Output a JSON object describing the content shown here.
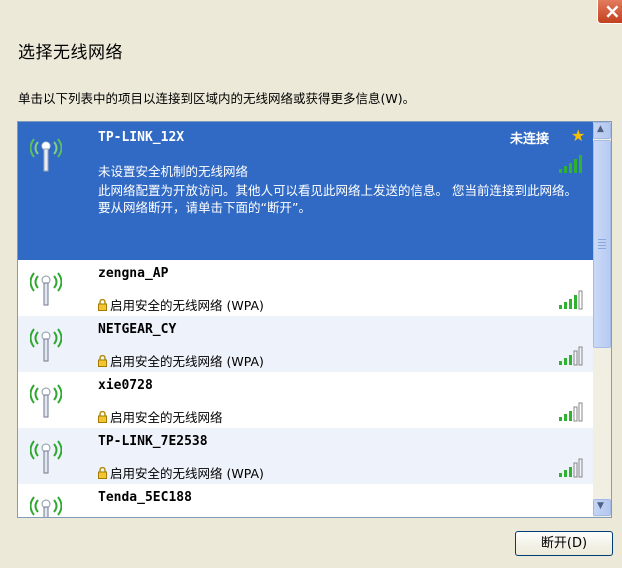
{
  "window": {
    "close_label": "×"
  },
  "header": {
    "title": "选择无线网络",
    "instruction": "单击以下列表中的项目以连接到区域内的无线网络或获得更多信息(W)。"
  },
  "networks": [
    {
      "ssid": "TP-LINK_12X",
      "status": "未连接",
      "security_text": "未设置安全机制的无线网络",
      "description": "此网络配置为开放访问。其他人可以看见此网络上发送的信息。 您当前连接到此网络。要从网络断开，请单击下面的“断开”。",
      "signal_level": 5,
      "preferred": true,
      "selected": true
    },
    {
      "ssid": "zengna_AP",
      "security_text": "启用安全的无线网络 (WPA)",
      "signal_level": 4
    },
    {
      "ssid": "NETGEAR_CY",
      "security_text": "启用安全的无线网络 (WPA)",
      "signal_level": 3
    },
    {
      "ssid": "xie0728",
      "security_text": "启用安全的无线网络",
      "signal_level": 3
    },
    {
      "ssid": "TP-LINK_7E2538",
      "security_text": "启用安全的无线网络 (WPA)",
      "signal_level": 3
    },
    {
      "ssid": "Tenda_5EC188"
    }
  ],
  "scrollbar": {
    "up_arrow": "▲",
    "down_arrow": "▼"
  },
  "buttons": {
    "disconnect_label": "断开(D)"
  },
  "colors": {
    "selection": "#316ac5",
    "signal_bar": "#2fb22f",
    "star": "#f6c000"
  }
}
